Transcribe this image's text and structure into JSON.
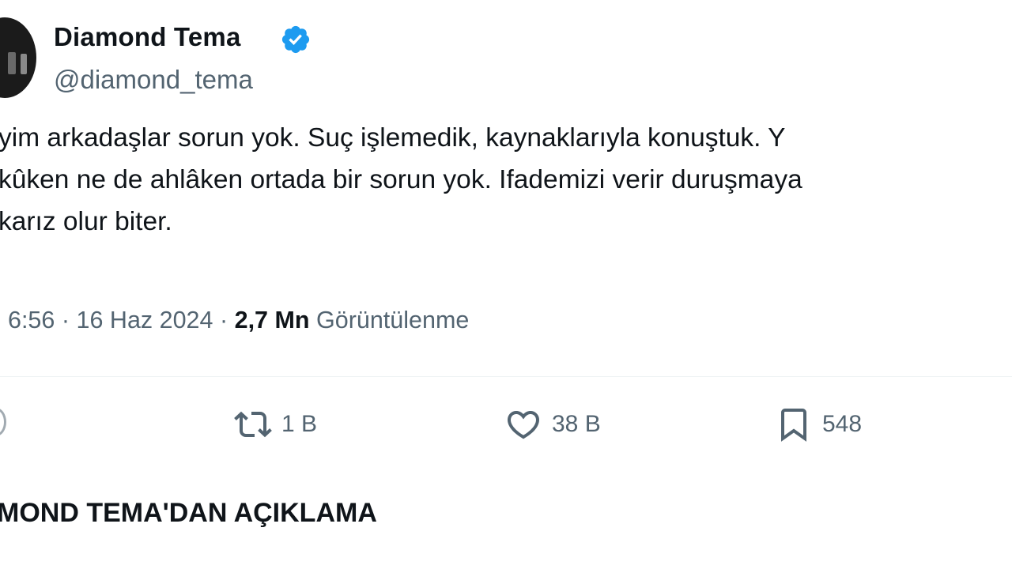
{
  "author": {
    "display_name": "Diamond Tema",
    "handle": "@diamond_tema",
    "verified_icon": "verified-badge-icon",
    "accent_color": "#1d9bf0"
  },
  "tweet": {
    "text_lines": [
      "yim arkadaşlar sorun yok. Suç işlemedik, kaynaklarıyla konuştuk. Y",
      "kûken ne de ahlâken ortada bir sorun yok. Ifademizi verir duruşmaya",
      "karız olur biter."
    ],
    "time": "6:56",
    "date": "16 Haz 2024",
    "separator": "·",
    "views_count": "2,7 Mn",
    "views_label": "Görüntülenme"
  },
  "actions": {
    "reply_icon": "reply-icon",
    "retweet_icon": "retweet-icon",
    "retweet_count": "1 B",
    "like_icon": "heart-icon",
    "like_count": "38 B",
    "bookmark_icon": "bookmark-icon",
    "bookmark_count": "548"
  },
  "article": {
    "headline": "MOND TEMA'DAN AÇIKLAMA"
  }
}
